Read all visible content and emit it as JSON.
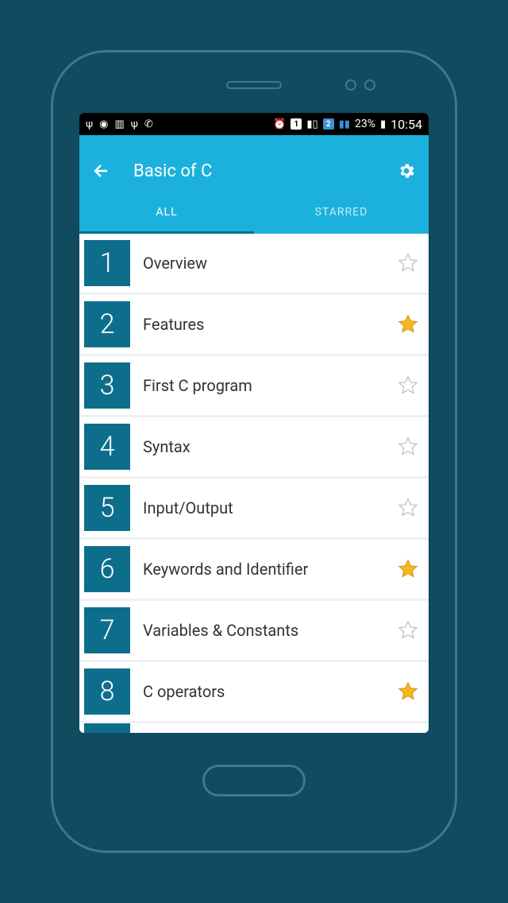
{
  "status_bar": {
    "battery_text": "23%",
    "time": "10:54"
  },
  "header": {
    "title": "Basic of C"
  },
  "tabs": {
    "all": "ALL",
    "starred": "STARRED",
    "active": "all"
  },
  "items": [
    {
      "num": "1",
      "label": "Overview",
      "starred": false
    },
    {
      "num": "2",
      "label": "Features",
      "starred": true
    },
    {
      "num": "3",
      "label": "First C program",
      "starred": false
    },
    {
      "num": "4",
      "label": "Syntax",
      "starred": false
    },
    {
      "num": "5",
      "label": "Input/Output",
      "starred": false
    },
    {
      "num": "6",
      "label": "Keywords and Identifier",
      "starred": true
    },
    {
      "num": "7",
      "label": "Variables & Constants",
      "starred": false
    },
    {
      "num": "8",
      "label": "C operators",
      "starred": true
    }
  ],
  "colors": {
    "page_bg": "#104b5f",
    "frame": "#3a7a8f",
    "appbar": "#1cb1dc",
    "num_box": "#0d6e8c",
    "star_filled": "#f5b81c",
    "star_empty": "#cccccc"
  }
}
